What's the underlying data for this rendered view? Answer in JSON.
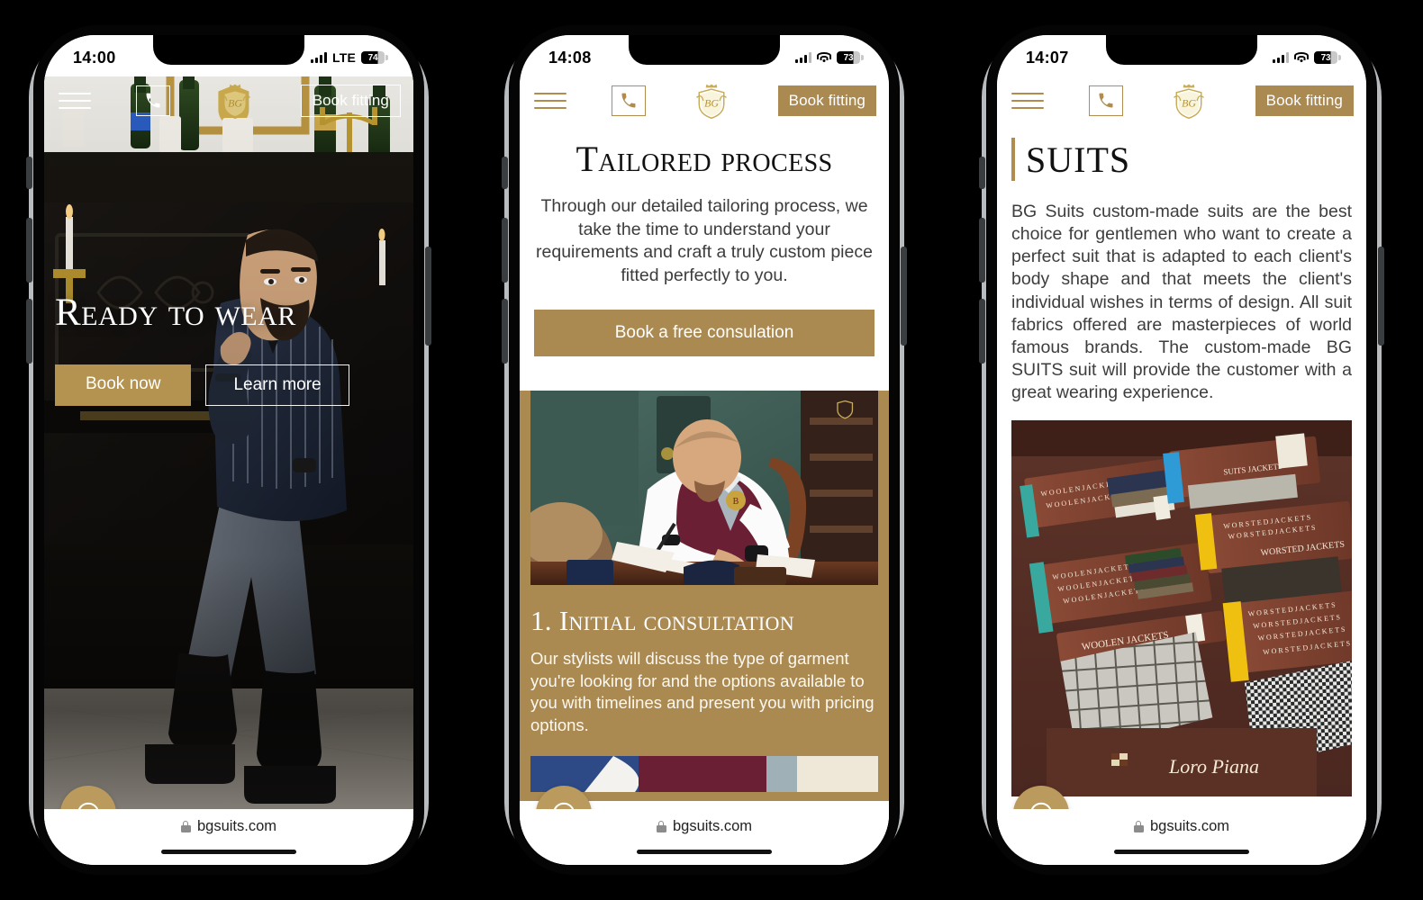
{
  "site": {
    "url": "bgsuits.com",
    "brand": "BG",
    "accent": "#ab8a52",
    "gold_light": "#b08d4f"
  },
  "phones": [
    {
      "id": "phone-1",
      "status": {
        "time": "14:00",
        "network": "LTE",
        "battery": "74",
        "wifi": false
      },
      "header": {
        "menu": "menu",
        "call": "phone-icon",
        "logo": "bg-crest-logo",
        "cta": "Book fitting"
      },
      "hero": {
        "title": "Ready to wear",
        "primary_button": "Book now",
        "secondary_button": "Learn more",
        "image_alt": "Man in pinstripe suit seated before a dark piano with champagne bottles and candles"
      },
      "fab": "whatsapp-icon"
    },
    {
      "id": "phone-2",
      "status": {
        "time": "14:08",
        "network": "",
        "battery": "73",
        "wifi": true
      },
      "header": {
        "menu": "menu",
        "call": "phone-icon",
        "logo": "bg-crest-logo",
        "cta": "Book fitting"
      },
      "intro": {
        "title": "Tailored process",
        "lead": "Through our detailed tailoring process, we take the time to understand your requirements and craft a truly custom piece fitted perfectly to you.",
        "cta": "Book a free consulation"
      },
      "step": {
        "heading": "1. Initial consultation",
        "body": "Our stylists will discuss the type of garment you're looking for and the options available to you with timelines and present you with pricing options.",
        "image_alt": "Tailor in burgundy waistcoat writing notes at a desk"
      },
      "fab": "whatsapp-icon"
    },
    {
      "id": "phone-3",
      "status": {
        "time": "14:07",
        "network": "",
        "battery": "73",
        "wifi": true
      },
      "header": {
        "menu": "menu",
        "call": "phone-icon",
        "logo": "bg-crest-logo",
        "cta": "Book fitting"
      },
      "suits": {
        "title": "SUITS",
        "body": "BG Suits custom-made suits are the best choice for gentlemen who want to create a perfect suit that is adapted to each client's body shape and that meets the client's individual wishes in terms of design. All suit fabrics offered are masterpieces of world famous brands. The custom-made BG SUITS suit will provide the customer with a great wearing experience.",
        "image_alt": "Loro Piana fabric swatch books labelled Woolen Jackets and Worsted Jackets"
      },
      "fab": "whatsapp-icon"
    }
  ]
}
